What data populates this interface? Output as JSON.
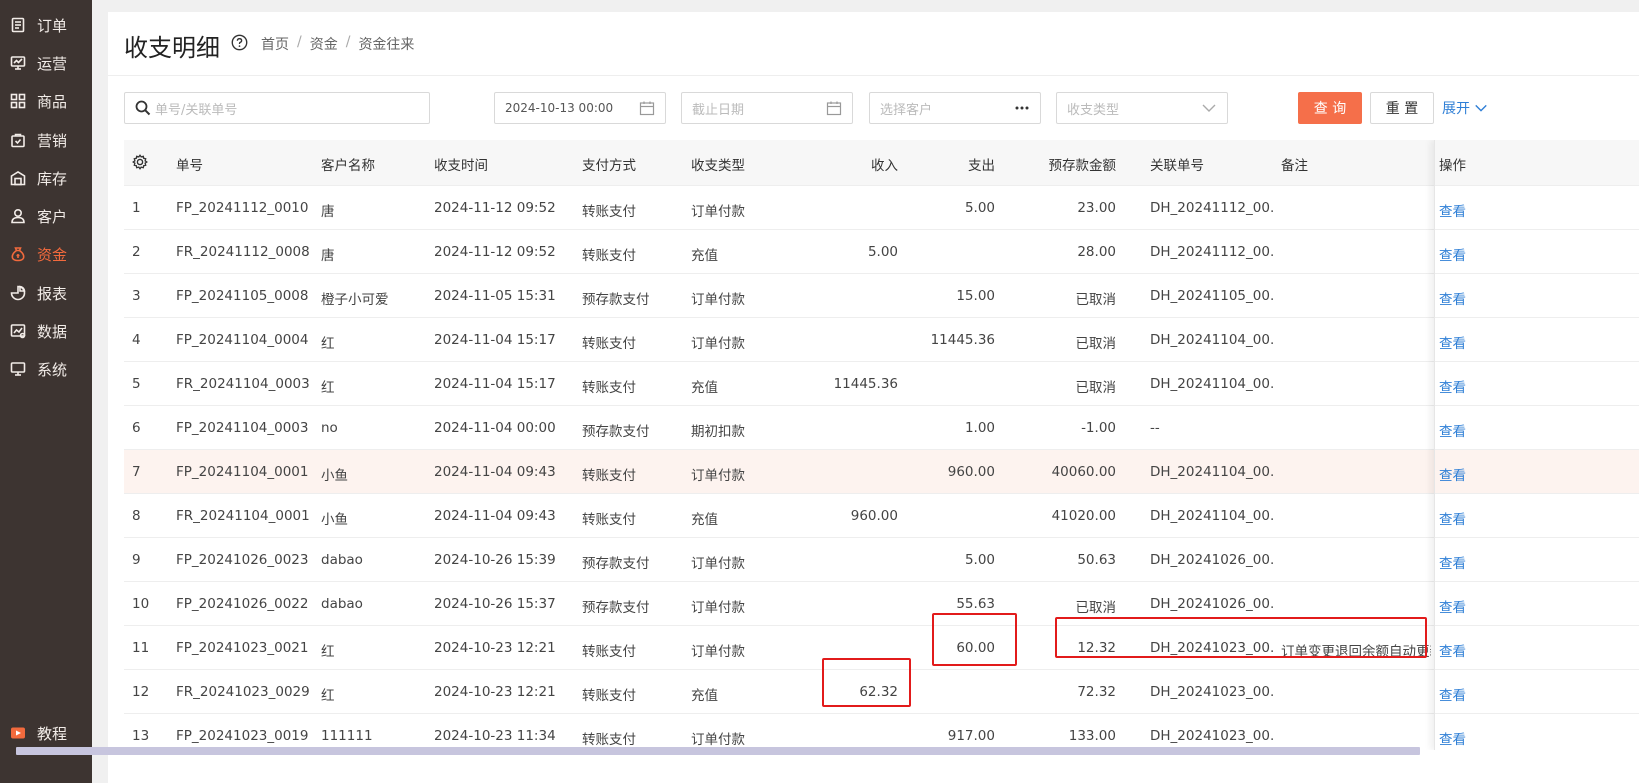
{
  "sidebar": {
    "items": [
      {
        "label": "订单",
        "icon": "order-icon"
      },
      {
        "label": "运营",
        "icon": "operation-icon"
      },
      {
        "label": "商品",
        "icon": "product-icon"
      },
      {
        "label": "营销",
        "icon": "marketing-icon"
      },
      {
        "label": "库存",
        "icon": "warehouse-icon"
      },
      {
        "label": "客户",
        "icon": "customer-icon"
      },
      {
        "label": "资金",
        "icon": "money-bag-icon",
        "active": true
      },
      {
        "label": "报表",
        "icon": "pie-chart-icon"
      },
      {
        "label": "数据",
        "icon": "data-icon"
      },
      {
        "label": "系统",
        "icon": "monitor-icon"
      }
    ],
    "bottom": {
      "label": "教程",
      "icon": "video-icon"
    }
  },
  "header": {
    "title": "收支明细",
    "breadcrumb": [
      "首页",
      "资金",
      "资金往来"
    ]
  },
  "filters": {
    "search_placeholder": "单号/关联单号",
    "start_date": "2024-10-13 00:00",
    "end_date_placeholder": "截止日期",
    "customer_placeholder": "选择客户",
    "type_placeholder": "收支类型",
    "query_label": "查 询",
    "reset_label": "重 置",
    "expand_label": "展开"
  },
  "table": {
    "columns": [
      "单号",
      "客户名称",
      "收支时间",
      "支付方式",
      "收支类型",
      "收入",
      "支出",
      "预存款金额",
      "关联单号",
      "备注",
      "操作"
    ],
    "rows": [
      {
        "idx": "1",
        "no": "FP_20241112_0010",
        "customer": "唐",
        "time": "2024-11-12 09:52",
        "pay": "转账支付",
        "type": "订单付款",
        "income": "",
        "expense": "5.00",
        "balance": "23.00",
        "ref": "DH_20241112_00...",
        "note": "",
        "op": "查看"
      },
      {
        "idx": "2",
        "no": "FR_20241112_0008",
        "customer": "唐",
        "time": "2024-11-12 09:52",
        "pay": "转账支付",
        "type": "充值",
        "income": "5.00",
        "expense": "",
        "balance": "28.00",
        "ref": "DH_20241112_00...",
        "note": "",
        "op": "查看"
      },
      {
        "idx": "3",
        "no": "FP_20241105_0008",
        "customer": "橙子小可爱",
        "time": "2024-11-05 15:31",
        "pay": "预存款支付",
        "type": "订单付款",
        "income": "",
        "expense": "15.00",
        "balance": "已取消",
        "ref": "DH_20241105_00...",
        "note": "",
        "op": "查看"
      },
      {
        "idx": "4",
        "no": "FP_20241104_0004",
        "customer": "红",
        "time": "2024-11-04 15:17",
        "pay": "转账支付",
        "type": "订单付款",
        "income": "",
        "expense": "11445.36",
        "balance": "已取消",
        "ref": "DH_20241104_00...",
        "note": "",
        "op": "查看"
      },
      {
        "idx": "5",
        "no": "FR_20241104_0003",
        "customer": "红",
        "time": "2024-11-04 15:17",
        "pay": "转账支付",
        "type": "充值",
        "income": "11445.36",
        "expense": "",
        "balance": "已取消",
        "ref": "DH_20241104_00...",
        "note": "",
        "op": "查看"
      },
      {
        "idx": "6",
        "no": "FP_20241104_0003",
        "customer": "no",
        "time": "2024-11-04 00:00",
        "pay": "预存款支付",
        "type": "期初扣款",
        "income": "",
        "expense": "1.00",
        "balance": "-1.00",
        "ref": "--",
        "note": "",
        "op": "查看"
      },
      {
        "idx": "7",
        "no": "FP_20241104_0001",
        "customer": "小鱼",
        "time": "2024-11-04 09:43",
        "pay": "转账支付",
        "type": "订单付款",
        "income": "",
        "expense": "960.00",
        "balance": "40060.00",
        "ref": "DH_20241104_00...",
        "note": "",
        "op": "查看"
      },
      {
        "idx": "8",
        "no": "FR_20241104_0001",
        "customer": "小鱼",
        "time": "2024-11-04 09:43",
        "pay": "转账支付",
        "type": "充值",
        "income": "960.00",
        "expense": "",
        "balance": "41020.00",
        "ref": "DH_20241104_00...",
        "note": "",
        "op": "查看"
      },
      {
        "idx": "9",
        "no": "FP_20241026_0023",
        "customer": "dabao",
        "time": "2024-10-26 15:39",
        "pay": "预存款支付",
        "type": "订单付款",
        "income": "",
        "expense": "5.00",
        "balance": "50.63",
        "ref": "DH_20241026_00...",
        "note": "",
        "op": "查看"
      },
      {
        "idx": "10",
        "no": "FP_20241026_0022",
        "customer": "dabao",
        "time": "2024-10-26 15:37",
        "pay": "预存款支付",
        "type": "订单付款",
        "income": "",
        "expense": "55.63",
        "balance": "已取消",
        "ref": "DH_20241026_00...",
        "note": "",
        "op": "查看"
      },
      {
        "idx": "11",
        "no": "FP_20241023_0021",
        "customer": "红",
        "time": "2024-10-23 12:21",
        "pay": "转账支付",
        "type": "订单付款",
        "income": "",
        "expense": "60.00",
        "balance": "12.32",
        "ref": "DH_20241023_00...",
        "note": "订单变更退回余额自动更新",
        "op": "查看"
      },
      {
        "idx": "12",
        "no": "FR_20241023_0029",
        "customer": "红",
        "time": "2024-10-23 12:21",
        "pay": "转账支付",
        "type": "充值",
        "income": "62.32",
        "expense": "",
        "balance": "72.32",
        "ref": "DH_20241023_00...",
        "note": "",
        "op": "查看"
      },
      {
        "idx": "13",
        "no": "FP_20241023_0019",
        "customer": "111111",
        "time": "2024-10-23 11:34",
        "pay": "转账支付",
        "type": "订单付款",
        "income": "",
        "expense": "917.00",
        "balance": "133.00",
        "ref": "DH_20241023_00...",
        "note": "",
        "op": "查看"
      }
    ]
  },
  "colors": {
    "sidebar_bg": "#3d3431",
    "accent": "#f56f4a",
    "link": "#2f7fd6",
    "highlight": "#e21b1b"
  }
}
